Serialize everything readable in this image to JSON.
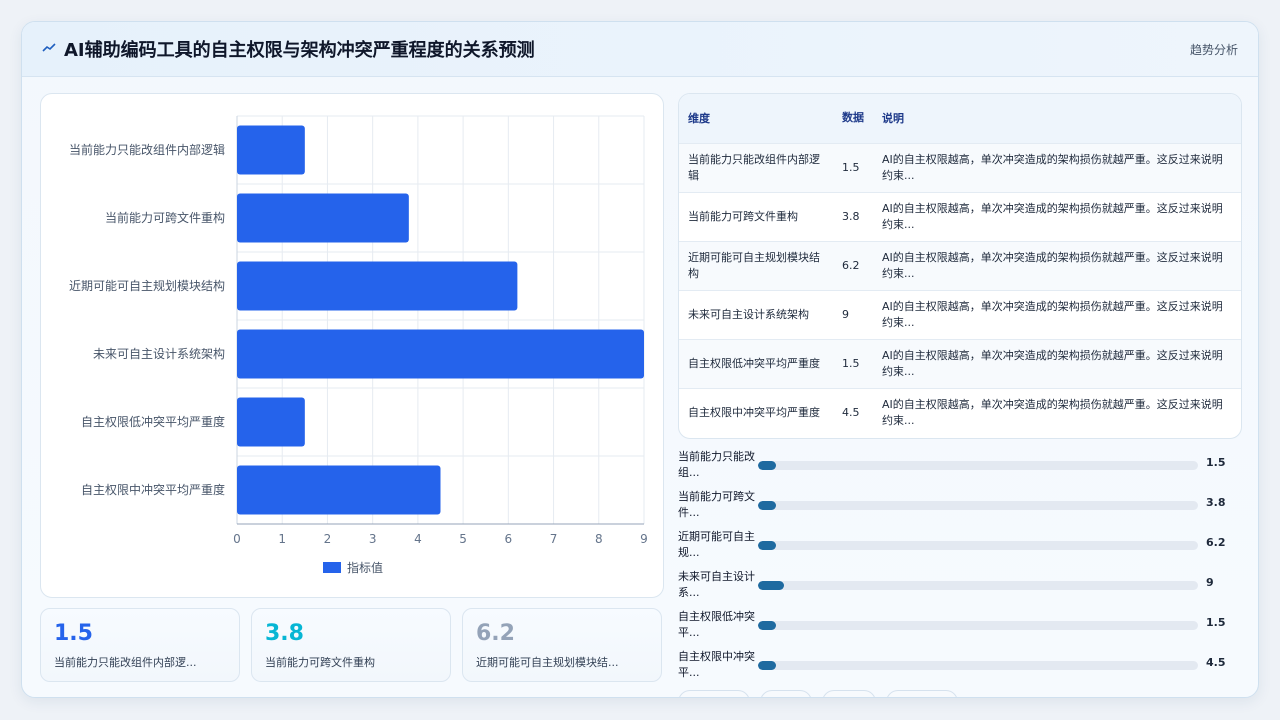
{
  "header": {
    "title": "AI辅助编码工具的自主权限与架构冲突严重程度的关系预测",
    "action_label": "趋势分析",
    "icon": "trend-line-icon"
  },
  "chart_data": {
    "type": "bar",
    "orientation": "horizontal",
    "categories": [
      "当前能力只能改组件内部逻辑",
      "当前能力可跨文件重构",
      "近期可能可自主规划模块结构",
      "未来可自主设计系统架构",
      "自主权限低冲突平均严重度",
      "自主权限中冲突平均严重度"
    ],
    "series": [
      {
        "name": "指标值",
        "values": [
          1.5,
          3.8,
          6.2,
          9,
          1.5,
          4.5
        ],
        "color": "#2563eb"
      }
    ],
    "xlim": [
      0,
      9
    ],
    "xticks": [
      0,
      1,
      2,
      3,
      4,
      5,
      6,
      7,
      8,
      9
    ],
    "grid": true,
    "legend": "bottom"
  },
  "table": {
    "headers": [
      "维度",
      "数据",
      "说明"
    ],
    "rows": [
      {
        "dim": "当前能力只能改组件内部逻辑",
        "val": "1.5",
        "desc": "AI的自主权限越高，单次冲突造成的架构损伤就越严重。这反过来说明约束..."
      },
      {
        "dim": "当前能力可跨文件重构",
        "val": "3.8",
        "desc": "AI的自主权限越高，单次冲突造成的架构损伤就越严重。这反过来说明约束..."
      },
      {
        "dim": "近期可能可自主规划模块结构",
        "val": "6.2",
        "desc": "AI的自主权限越高，单次冲突造成的架构损伤就越严重。这反过来说明约束..."
      },
      {
        "dim": "未来可自主设计系统架构",
        "val": "9",
        "desc": "AI的自主权限越高，单次冲突造成的架构损伤就越严重。这反过来说明约束..."
      },
      {
        "dim": "自主权限低冲突平均严重度",
        "val": "1.5",
        "desc": "AI的自主权限越高，单次冲突造成的架构损伤就越严重。这反过来说明约束..."
      },
      {
        "dim": "自主权限中冲突平均严重度",
        "val": "4.5",
        "desc": "AI的自主权限越高，单次冲突造成的架构损伤就越严重。这反过来说明约束..."
      }
    ]
  },
  "progress": [
    {
      "label": "当前能力只能改组...",
      "value": 1.5,
      "display": "1.5"
    },
    {
      "label": "当前能力可跨文件...",
      "value": 3.8,
      "display": "3.8"
    },
    {
      "label": "近期可能可自主规...",
      "value": 6.2,
      "display": "6.2"
    },
    {
      "label": "未来可自主设计系...",
      "value": 9,
      "display": "9"
    },
    {
      "label": "自主权限低冲突平...",
      "value": 1.5,
      "display": "1.5"
    },
    {
      "label": "自主权限中冲突平...",
      "value": 4.5,
      "display": "4.5"
    }
  ],
  "stats": [
    {
      "value": "1.5",
      "label": "当前能力只能改组件内部逻...",
      "color": "#2563eb"
    },
    {
      "value": "3.8",
      "label": "当前能力可跨文件重构",
      "color": "#06b6d4"
    },
    {
      "value": "6.2",
      "label": "近期可能可自主规划模块结...",
      "color": "#94a3b8"
    }
  ]
}
